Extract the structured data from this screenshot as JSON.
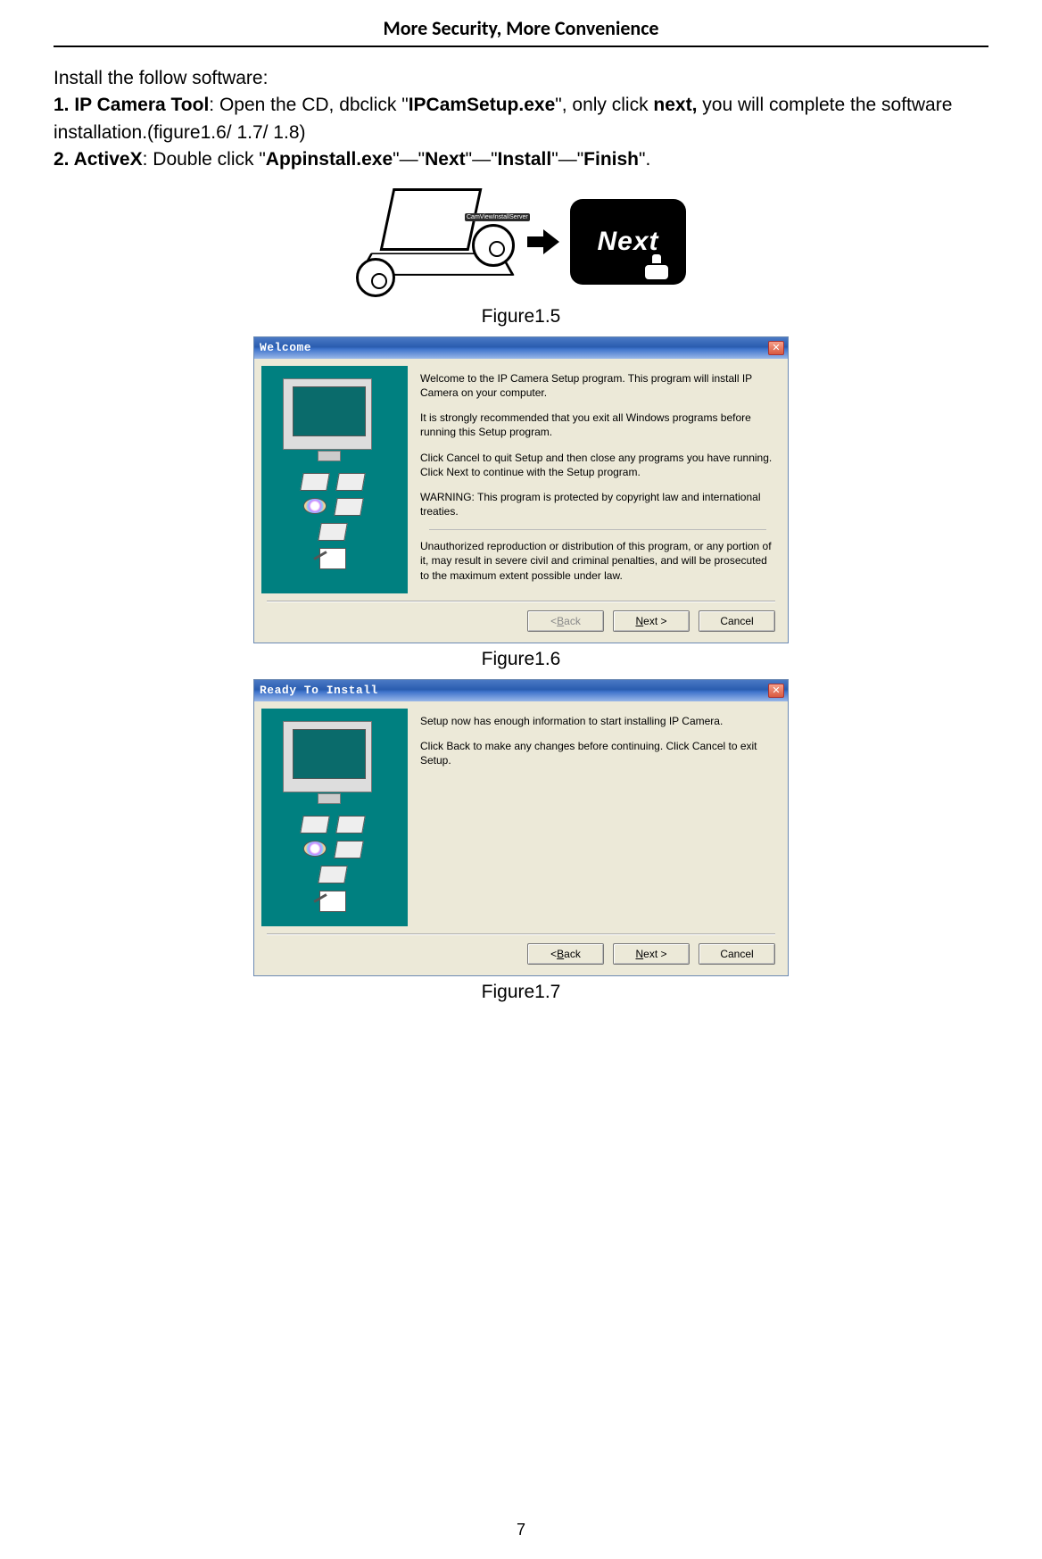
{
  "header": {
    "title": "More Security, More Convenience"
  },
  "intro": {
    "line1": "Install the follow software:",
    "item1_bold": "1. IP Camera Tool",
    "item1_rest_a": ": Open the CD, dbclick \"",
    "item1_file": "IPCamSetup.exe",
    "item1_rest_b": "\", only click ",
    "item1_next": "next,",
    "item1_rest_c": " you will complete the software installation.(figure1.6/ 1.7/ 1.8)",
    "item2_bold": "2. ActiveX",
    "item2_rest_a": ": Double click \"",
    "item2_file": "Appinstall.exe",
    "item2_rest_b": "\"—\"",
    "item2_step2": "Next",
    "item2_rest_c": "\"—\"",
    "item2_step3": "Install",
    "item2_rest_d": "\"—\"",
    "item2_step4": "Finish",
    "item2_rest_e": "\"."
  },
  "fig15": {
    "caption": "Figure1.5",
    "cd_label": "CamViewInstallServer",
    "next_label": "Next"
  },
  "fig16": {
    "caption": "Figure1.6",
    "title": "Welcome",
    "p1": "Welcome to the IP Camera Setup program. This program will install IP Camera on your computer.",
    "p2": "It is strongly recommended that you exit all Windows programs before running this Setup program.",
    "p3": "Click Cancel to quit Setup and then close any programs you have running. Click Next to continue with the Setup program.",
    "p4": "WARNING: This program is protected by copyright law and international treaties.",
    "p5": "Unauthorized reproduction or distribution of this program, or any portion of it, may result in severe civil and criminal penalties, and will be prosecuted to the maximum extent possible under law.",
    "btn_back_pre": "< ",
    "btn_back_u": "B",
    "btn_back_post": "ack",
    "btn_next_u": "N",
    "btn_next_post": "ext >",
    "btn_cancel": "Cancel",
    "close": "✕"
  },
  "fig17": {
    "caption": "Figure1.7",
    "title": "Ready To Install",
    "p1": "Setup now has enough information to start installing IP Camera.",
    "p2": "Click Back to make any changes before continuing. Click Cancel to exit Setup.",
    "btn_back_pre": "< ",
    "btn_back_u": "B",
    "btn_back_post": "ack",
    "btn_next_u": "N",
    "btn_next_post": "ext >",
    "btn_cancel": "Cancel",
    "close": "✕"
  },
  "page_number": "7"
}
